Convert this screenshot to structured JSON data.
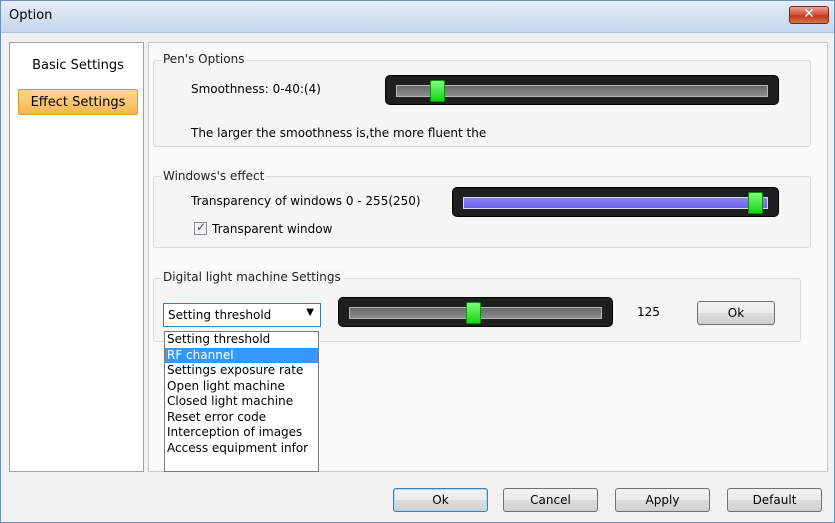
{
  "window": {
    "title": "Option"
  },
  "sidebar": {
    "items": [
      {
        "label": "Basic Settings"
      },
      {
        "label": "Effect Settings"
      }
    ]
  },
  "pen_options": {
    "legend": "Pen's Options",
    "smoothness_label": "Smoothness: 0-40:(4)",
    "smoothness_value": 4,
    "smoothness_max": 40,
    "description": "The larger the smoothness is,the more fluent the"
  },
  "windows_effect": {
    "legend": "Windows's effect",
    "transparency_label": "Transparency of windows 0 - 255(250)",
    "transparency_value": 250,
    "transparency_max": 255,
    "checkbox_label": "Transparent window",
    "checkbox_checked": true
  },
  "dlm": {
    "legend": "Digital light machine Settings",
    "combo_value": "Setting threshold",
    "slider_value": 125,
    "value_text": "125",
    "ok_label": "Ok",
    "options": [
      "Setting threshold",
      "RF channel",
      "Settings exposure rate",
      "Open light machine",
      "Closed light machine",
      "Reset error code",
      "Interception of images",
      "Access equipment infor"
    ],
    "highlighted_index": 1
  },
  "footer": {
    "ok": "Ok",
    "cancel": "Cancel",
    "apply": "Apply",
    "default": "Default"
  },
  "colors": {
    "selected_tab": "#f7b649",
    "slider_thumb": "#17d317",
    "highlight": "#3399ff"
  }
}
